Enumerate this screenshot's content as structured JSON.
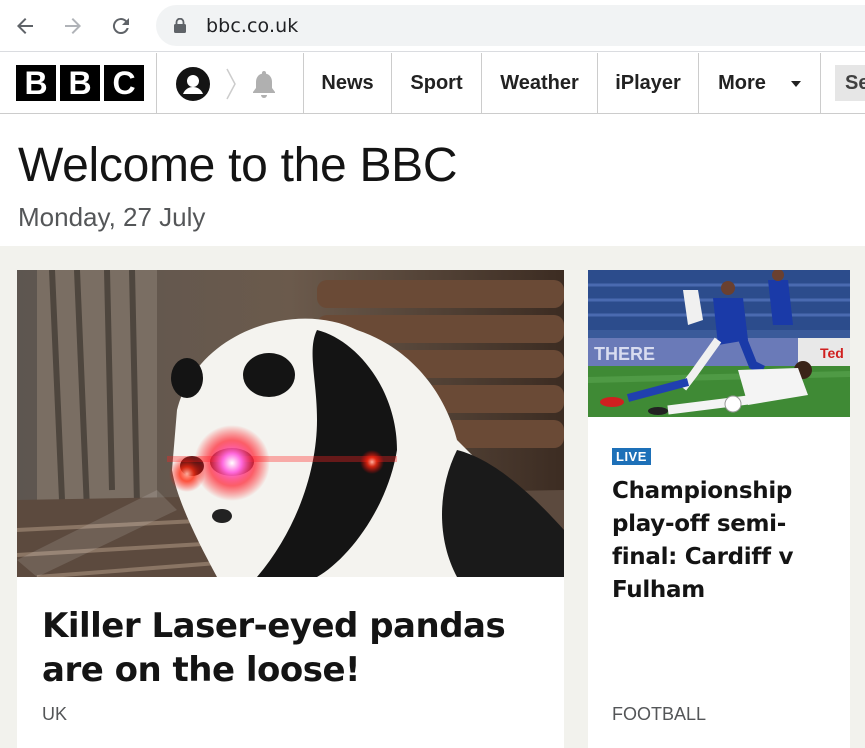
{
  "browser": {
    "url": "bbc.co.uk"
  },
  "bbc_nav": {
    "logo_letters": [
      "B",
      "B",
      "C"
    ],
    "items": [
      {
        "label": "News"
      },
      {
        "label": "Sport"
      },
      {
        "label": "Weather"
      },
      {
        "label": "iPlayer"
      },
      {
        "label": "More"
      }
    ],
    "search_label": "Se"
  },
  "header": {
    "title": "Welcome to the BBC",
    "date": "Monday, 27 July"
  },
  "main_story": {
    "image_icon": "panda-image",
    "headline": "Killer Laser-eyed pandas are on the loose!",
    "tag": "UK"
  },
  "side_story": {
    "image_icon": "football-image",
    "badge": "LIVE",
    "headline": "Championship play-off semi-final: Cardiff v Fulham",
    "tag": "FOOTBALL"
  },
  "colors": {
    "live_badge": "#1d70b8",
    "content_bg": "#f2f2ed"
  }
}
